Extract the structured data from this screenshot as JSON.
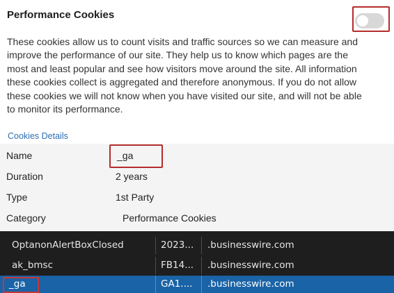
{
  "panel": {
    "title": "Performance Cookies",
    "toggle": {
      "state": "off"
    },
    "description_lines": [
      "These cookies allow us to count visits and traffic sources so we can measure and",
      "improve the performance of our site. They help us to know which pages are the",
      "most and least popular and see how visitors move around the site. All information",
      "these cookies collect is aggregated and therefore anonymous. If you do not allow",
      "these cookies we will not know when you have visited our site, and will not be able",
      "to monitor its performance."
    ],
    "details_link": "Cookies Details"
  },
  "cookie_info": [
    {
      "label": "Name",
      "value": "_ga"
    },
    {
      "label": "Duration",
      "value": "2 years"
    },
    {
      "label": "Type",
      "value": "1st Party"
    },
    {
      "label": "Category",
      "value": "Performance Cookies"
    }
  ],
  "devtools_rows": [
    {
      "name": "OptanonAlertBoxClosed",
      "value": "2023...",
      "domain": ".businesswire.com",
      "selected": false
    },
    {
      "name": "ak_bmsc",
      "value": "FB14...",
      "domain": ".businesswire.com",
      "selected": false
    },
    {
      "name": "_ga",
      "value": "GA1....",
      "domain": ".businesswire.com",
      "selected": true
    }
  ],
  "colors": {
    "highlight_border": "#b42b2b",
    "link": "#2b6fb6",
    "devtools_bg": "#1e1e1e",
    "selected_row": "#1a63a6"
  }
}
